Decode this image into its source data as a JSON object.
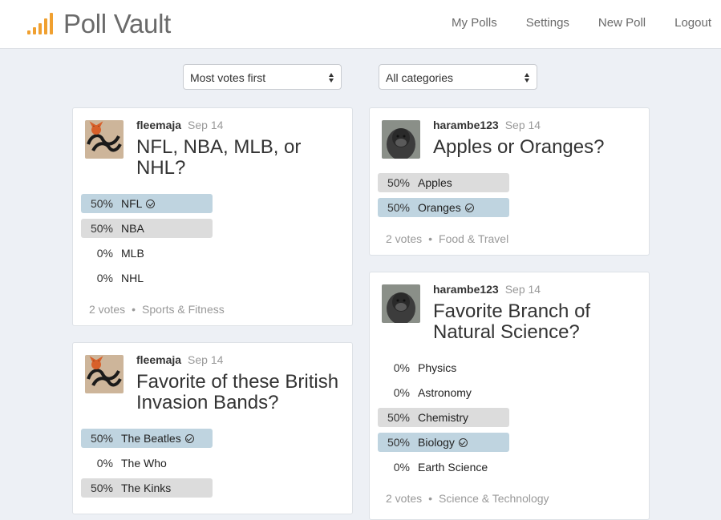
{
  "app": {
    "title": "Poll Vault"
  },
  "nav": {
    "my_polls": "My Polls",
    "settings": "Settings",
    "new_poll": "New Poll",
    "logout": "Logout"
  },
  "filters": {
    "sort_value": "Most votes first",
    "category_value": "All categories"
  },
  "colors": {
    "accent": "#f0a030",
    "winner_bar": "#bfd4e0",
    "other_bar": "#dcdcdc"
  },
  "polls": [
    {
      "user": "fleemaja",
      "date": "Sep 14",
      "question": "NFL, NBA, MLB, or NHL?",
      "options": [
        {
          "pct": "50%",
          "label": "NFL",
          "winner": true,
          "share": 0.5
        },
        {
          "pct": "50%",
          "label": "NBA",
          "winner": false,
          "share": 0.5
        },
        {
          "pct": "0%",
          "label": "MLB",
          "winner": false,
          "share": 0
        },
        {
          "pct": "0%",
          "label": "NHL",
          "winner": false,
          "share": 0
        }
      ],
      "votes": "2 votes",
      "category": "Sports & Fitness"
    },
    {
      "user": "fleemaja",
      "date": "Sep 14",
      "question": "Favorite of these British Invasion Bands?",
      "options": [
        {
          "pct": "50%",
          "label": "The Beatles",
          "winner": true,
          "share": 0.5
        },
        {
          "pct": "0%",
          "label": "The Who",
          "winner": false,
          "share": 0
        },
        {
          "pct": "50%",
          "label": "The Kinks",
          "winner": false,
          "share": 0.5
        }
      ]
    },
    {
      "user": "harambe123",
      "date": "Sep 14",
      "question": "Apples or Oranges?",
      "options": [
        {
          "pct": "50%",
          "label": "Apples",
          "winner": false,
          "share": 0.5
        },
        {
          "pct": "50%",
          "label": "Oranges",
          "winner": true,
          "share": 0.5
        }
      ],
      "votes": "2 votes",
      "category": "Food & Travel"
    },
    {
      "user": "harambe123",
      "date": "Sep 14",
      "question": "Favorite Branch of Natural Science?",
      "options": [
        {
          "pct": "0%",
          "label": "Physics",
          "winner": false,
          "share": 0
        },
        {
          "pct": "0%",
          "label": "Astronomy",
          "winner": false,
          "share": 0
        },
        {
          "pct": "50%",
          "label": "Chemistry",
          "winner": false,
          "share": 0.5
        },
        {
          "pct": "50%",
          "label": "Biology",
          "winner": true,
          "share": 0.5
        },
        {
          "pct": "0%",
          "label": "Earth Science",
          "winner": false,
          "share": 0
        }
      ],
      "votes": "2 votes",
      "category": "Science & Technology"
    }
  ]
}
